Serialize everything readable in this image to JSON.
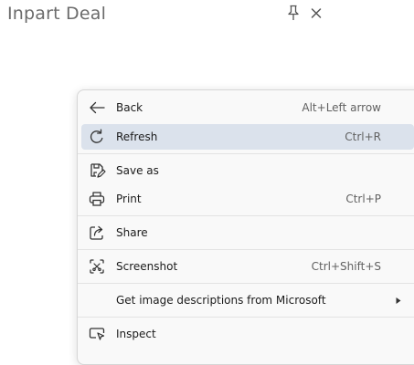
{
  "window": {
    "title": "Inpart Deal"
  },
  "menu": {
    "items": [
      {
        "label": "Back",
        "shortcut": "Alt+Left arrow",
        "icon": "back-arrow-icon"
      },
      {
        "label": "Refresh",
        "shortcut": "Ctrl+R",
        "icon": "refresh-icon",
        "highlighted": true
      },
      {
        "label": "Save as",
        "shortcut": "",
        "icon": "save-as-icon"
      },
      {
        "label": "Print",
        "shortcut": "Ctrl+P",
        "icon": "print-icon"
      },
      {
        "label": "Share",
        "shortcut": "",
        "icon": "share-icon"
      },
      {
        "label": "Screenshot",
        "shortcut": "Ctrl+Shift+S",
        "icon": "screenshot-icon"
      },
      {
        "label": "Get image descriptions from Microsoft",
        "shortcut": "",
        "icon": "",
        "submenu": true
      },
      {
        "label": "Inspect",
        "shortcut": "",
        "icon": "inspect-icon"
      }
    ]
  },
  "colors": {
    "highlight": "#dbe2ec",
    "menu_bg": "#f9f9f9",
    "title_text": "#6b6b6b"
  }
}
